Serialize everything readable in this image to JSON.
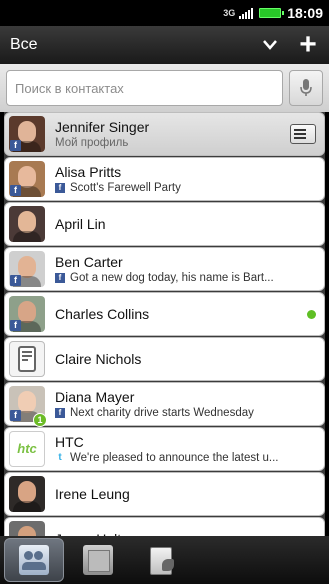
{
  "status_bar": {
    "network": "3G",
    "time": "18:09"
  },
  "header": {
    "title": "Все"
  },
  "search": {
    "placeholder": "Поиск в контактах"
  },
  "contacts": [
    {
      "name": "Jennifer Singer",
      "status": "Мой профиль",
      "source": "",
      "me": true,
      "avatar_bg": "#5b3a2c",
      "avatar_skin": "#e0b498",
      "badge": "f"
    },
    {
      "name": "Alisa Pritts",
      "status": "Scott's Farewell Party",
      "source": "f",
      "avatar_bg": "#a87a52",
      "avatar_skin": "#e7b99c",
      "badge": "f"
    },
    {
      "name": "April Lin",
      "status": "",
      "source": "",
      "avatar_bg": "#4b3a37",
      "avatar_skin": "#e3b797",
      "badge": ""
    },
    {
      "name": "Ben Carter",
      "status": "Got a new dog today, his name is Bart...",
      "source": "f",
      "avatar_bg": "#cfcfcf",
      "avatar_skin": "#e2b394",
      "badge": "f"
    },
    {
      "name": "Charles Collins",
      "status": "",
      "source": "",
      "online": true,
      "avatar_bg": "#8ea08a",
      "avatar_skin": "#d7a587",
      "badge": "f"
    },
    {
      "name": "Claire Nichols",
      "status": "",
      "source": "",
      "placeholder_avatar": true,
      "badge": ""
    },
    {
      "name": "Diana Mayer",
      "status": "Next charity drive starts Wednesday",
      "source": "f",
      "avatar_bg": "#c9c2b8",
      "avatar_skin": "#f0cdb4",
      "badge": "f",
      "notif": "1"
    },
    {
      "name": "HTC",
      "status": "We're pleased to announce the latest u...",
      "source": "t",
      "htc": true,
      "badge": ""
    },
    {
      "name": "Irene Leung",
      "status": "",
      "source": "",
      "avatar_bg": "#2e2a28",
      "avatar_skin": "#d8a484",
      "badge": ""
    },
    {
      "name": "Jason Holt",
      "status": "",
      "source": "",
      "avatar_bg": "#6d6d6d",
      "avatar_skin": "#d3a07e",
      "badge": ""
    }
  ],
  "htc_logo_text": "htc",
  "bottom_tabs": [
    {
      "name": "people",
      "active": true
    },
    {
      "name": "groups",
      "active": false
    },
    {
      "name": "call-history",
      "active": false
    }
  ]
}
